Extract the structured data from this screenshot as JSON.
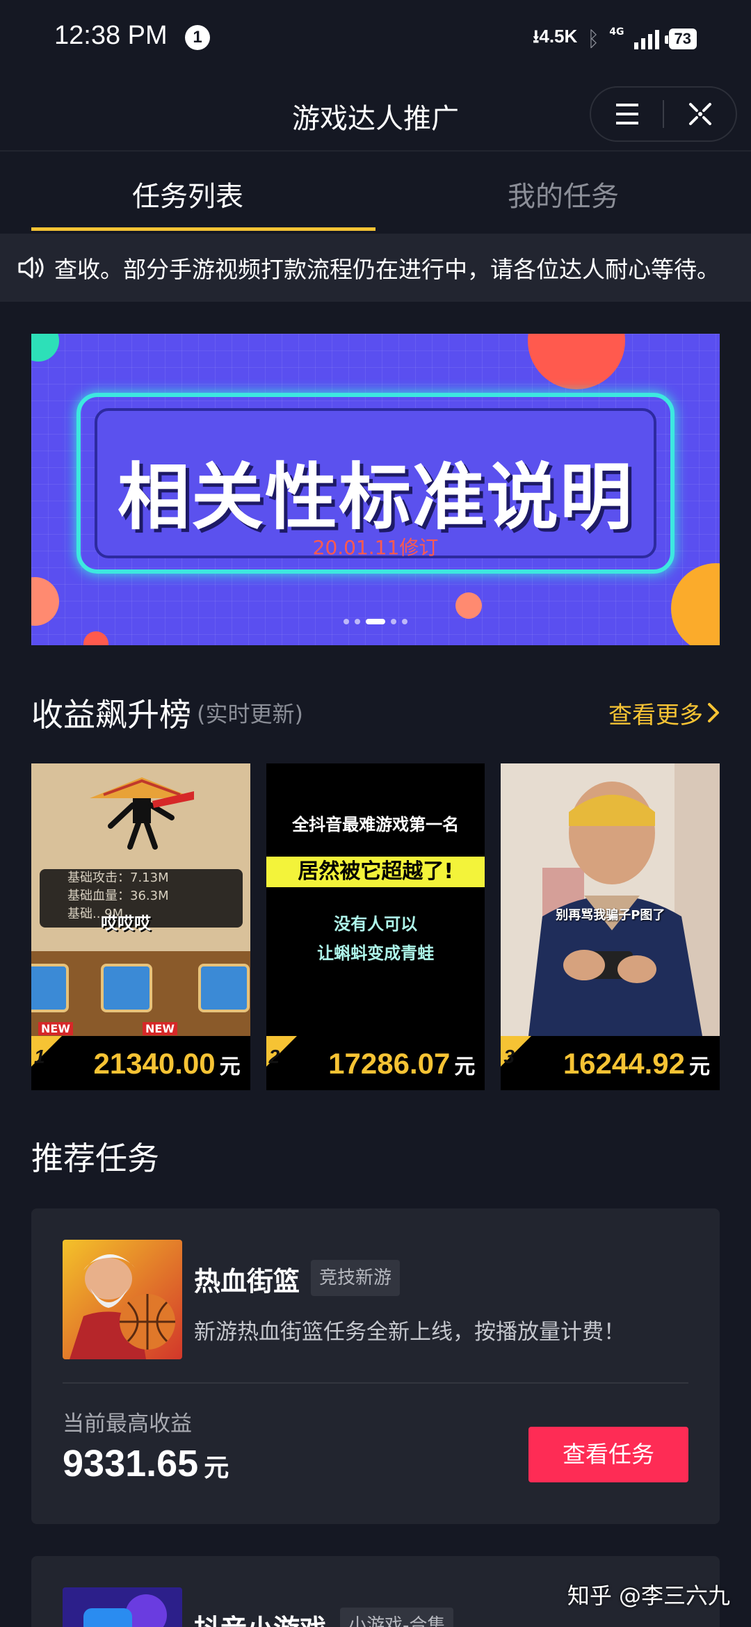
{
  "status_bar": {
    "time": "12:38 PM",
    "notification_count": "1",
    "net_speed": "4.5K",
    "network": "4G",
    "battery": "73"
  },
  "header": {
    "title": "游戏达人推广"
  },
  "tabs": [
    {
      "label": "任务列表",
      "active": true
    },
    {
      "label": "我的任务",
      "active": false
    }
  ],
  "notice": {
    "text": "查收。部分手游视频打款流程仍在进行中，请各位达人耐心等待。"
  },
  "banner": {
    "title": "相关性标准说明",
    "subtitle": "20.01.11修订",
    "slide_count": 5,
    "active_slide": 2
  },
  "ranking": {
    "title": "收益飙升榜",
    "subtitle": "(实时更新)",
    "more_label": "查看更多",
    "items": [
      {
        "rank": "1",
        "amount": "21340.00",
        "unit": "元",
        "thumb_lines": [
          "基础攻击：7.13M",
          "基础血量：36.3M",
          "基础...9M"
        ],
        "thumb_overlay": "哎哎哎",
        "thumb_new": "NEW"
      },
      {
        "rank": "2",
        "amount": "17286.07",
        "unit": "元",
        "thumb_line1": "全抖音最难游戏第一名",
        "thumb_line2": "居然被它超越了!",
        "thumb_line3": "没有人可以",
        "thumb_line4": "让蝌蚪变成青蛙"
      },
      {
        "rank": "3",
        "amount": "16244.92",
        "unit": "元",
        "thumb_caption": "别再骂我骗子P图了"
      }
    ]
  },
  "recommend": {
    "title": "推荐任务",
    "tasks": [
      {
        "name": "热血街篮",
        "tag": "竞技新游",
        "desc": "新游热血街篮任务全新上线，按播放量计费！",
        "earn_label": "当前最高收益",
        "earn": "9331.65",
        "unit": "元",
        "button": "查看任务"
      },
      {
        "name": "抖音小游戏",
        "tag": "小游戏-合集"
      }
    ]
  },
  "watermark": "知乎 @李三六九",
  "colors": {
    "background": "#151823",
    "accent_yellow": "#f6c334",
    "button_red": "#fe2c55",
    "card": "#22252f"
  }
}
